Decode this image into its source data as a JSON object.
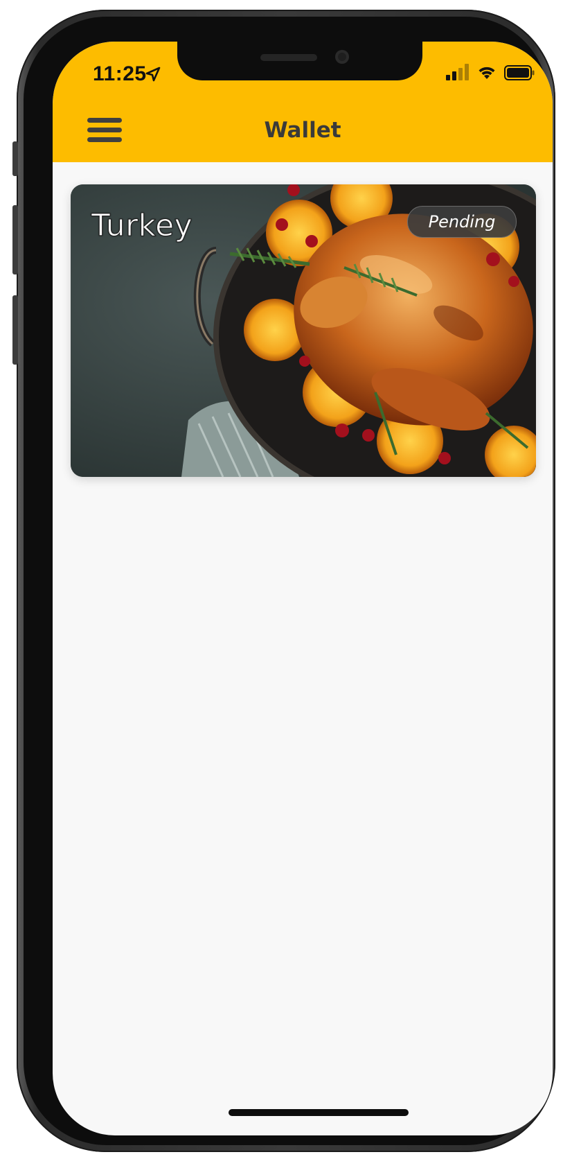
{
  "status_bar": {
    "time": "11:25",
    "icons": [
      "location-arrow-icon",
      "cellular-signal-icon",
      "wifi-icon",
      "battery-icon"
    ]
  },
  "header": {
    "title": "Wallet",
    "menu_icon": "hamburger-menu-icon",
    "background_color": "#fdbc00"
  },
  "wallet": {
    "cards": [
      {
        "title": "Turkey",
        "status": "Pending",
        "image": "roast-turkey-photo"
      }
    ]
  }
}
